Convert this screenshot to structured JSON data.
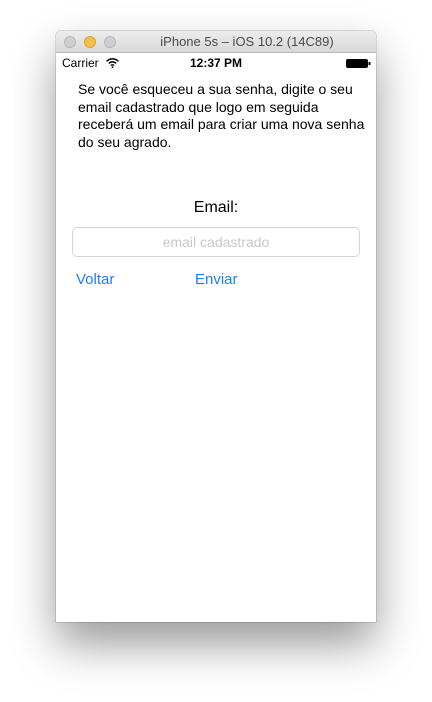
{
  "window": {
    "title": "iPhone 5s – iOS 10.2 (14C89)"
  },
  "status_bar": {
    "carrier": "Carrier",
    "time": "12:37 PM"
  },
  "screen": {
    "instructions": "Se você esqueceu a sua senha, digite o seu email cadastrado que logo em seguida receberá um email para criar uma nova senha do seu agrado.",
    "email_label": "Email:",
    "email_placeholder": "email cadastrado",
    "email_value": "",
    "back_label": "Voltar",
    "send_label": "Enviar"
  },
  "colors": {
    "accent": "#1a7ef6",
    "placeholder": "#c7c7cd",
    "minimize": "#f4bf4f"
  }
}
